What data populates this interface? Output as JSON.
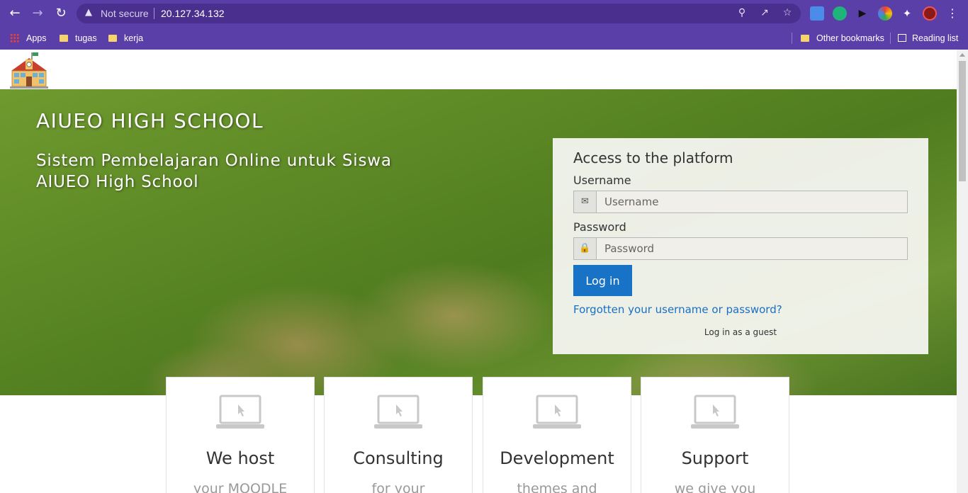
{
  "browser": {
    "security_label": "Not secure",
    "url": "20.127.34.132",
    "bookmarks": {
      "apps": "Apps",
      "items": [
        "tugas",
        "kerja"
      ],
      "other": "Other bookmarks",
      "reading_list": "Reading list"
    }
  },
  "hero": {
    "title": "AIUEO HIGH SCHOOL",
    "subtitle_line1": "Sistem Pembelajaran Online untuk Siswa",
    "subtitle_line2": "AIUEO High School"
  },
  "login": {
    "title": "Access to the platform",
    "username_label": "Username",
    "username_placeholder": "Username",
    "password_label": "Password",
    "password_placeholder": "Password",
    "login_button": "Log in",
    "forgot_link": "Forgotten your username or password?",
    "guest_link": "Log in as a guest"
  },
  "cards": [
    {
      "title": "We host",
      "text": "your MOODLE"
    },
    {
      "title": "Consulting",
      "text": "for your"
    },
    {
      "title": "Development",
      "text": "themes and"
    },
    {
      "title": "Support",
      "text": "we give you"
    }
  ]
}
